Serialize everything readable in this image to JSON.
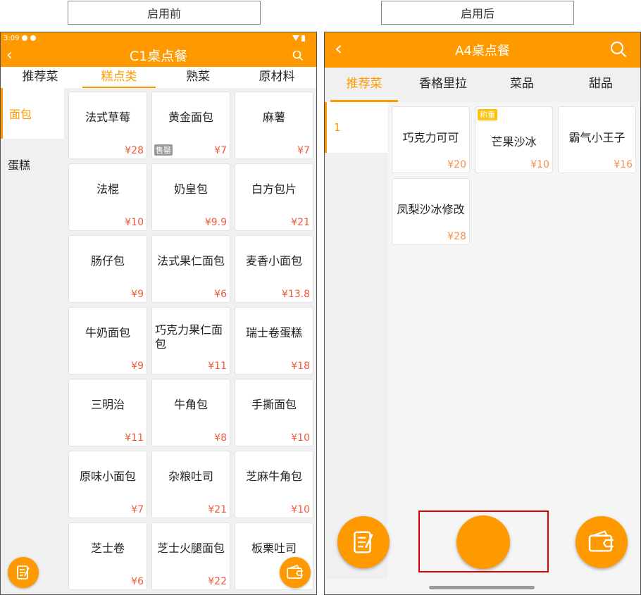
{
  "captions": {
    "before": "启用前",
    "after": "启用后"
  },
  "left": {
    "status": {
      "time": "3:09"
    },
    "title": "C1桌点餐",
    "tabs": [
      {
        "label": "推荐菜",
        "active": false
      },
      {
        "label": "糕点类",
        "active": true
      },
      {
        "label": "熟菜",
        "active": false
      },
      {
        "label": "原材料",
        "active": false
      }
    ],
    "sidebar": [
      {
        "label": "面包",
        "active": true
      },
      {
        "label": "蛋糕",
        "active": false
      }
    ],
    "items": [
      {
        "name": "法式草莓",
        "price": "¥28",
        "tag": ""
      },
      {
        "name": "黄金面包",
        "price": "¥7",
        "tag": "售罄"
      },
      {
        "name": "麻薯",
        "price": "¥7",
        "tag": ""
      },
      {
        "name": "法棍",
        "price": "¥10",
        "tag": ""
      },
      {
        "name": "奶皇包",
        "price": "¥9.9",
        "tag": ""
      },
      {
        "name": "白方包片",
        "price": "¥21",
        "tag": ""
      },
      {
        "name": "肠仔包",
        "price": "¥9",
        "tag": ""
      },
      {
        "name": "法式果仁面包",
        "price": "¥6",
        "tag": ""
      },
      {
        "name": "麦香小面包",
        "price": "¥13.8",
        "tag": ""
      },
      {
        "name": "牛奶面包",
        "price": "¥9",
        "tag": ""
      },
      {
        "name": "巧克力果仁面包",
        "price": "¥11",
        "tag": ""
      },
      {
        "name": "瑞士卷蛋糕",
        "price": "¥18",
        "tag": ""
      },
      {
        "name": "三明治",
        "price": "¥11",
        "tag": ""
      },
      {
        "name": "牛角包",
        "price": "¥8",
        "tag": ""
      },
      {
        "name": "手撕面包",
        "price": "¥10",
        "tag": ""
      },
      {
        "name": "原味小面包",
        "price": "¥7",
        "tag": ""
      },
      {
        "name": "杂粮吐司",
        "price": "¥21",
        "tag": ""
      },
      {
        "name": "芝麻牛角包",
        "price": "¥10",
        "tag": ""
      },
      {
        "name": "芝士卷",
        "price": "¥6",
        "tag": ""
      },
      {
        "name": "芝士火腿面包",
        "price": "¥22",
        "tag": ""
      },
      {
        "name": "板栗吐司",
        "price": "",
        "tag": ""
      }
    ]
  },
  "right": {
    "title": "A4桌点餐",
    "tabs": [
      {
        "label": "推荐菜",
        "active": true
      },
      {
        "label": "香格里拉",
        "active": false
      },
      {
        "label": "菜品",
        "active": false
      },
      {
        "label": "甜品",
        "active": false
      }
    ],
    "sidebar": [
      {
        "label": "1",
        "active": true
      }
    ],
    "items": [
      {
        "name": "巧克力可可",
        "price": "¥20",
        "tag": ""
      },
      {
        "name": "芒果沙冰",
        "price": "¥10",
        "tag": "称重"
      },
      {
        "name": "霸气小王子",
        "price": "¥16",
        "tag": ""
      },
      {
        "name": "凤梨沙冰修改",
        "price": "¥28",
        "tag": ""
      }
    ]
  },
  "colors": {
    "accent": "#ff9900",
    "price": "#f05a3a",
    "highlight": "#e00000"
  }
}
